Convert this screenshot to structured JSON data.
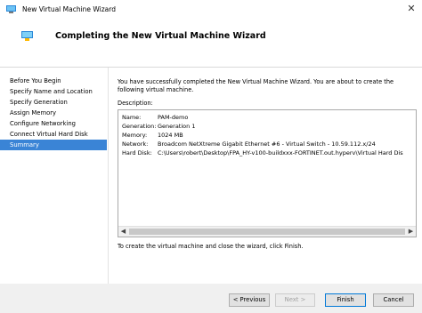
{
  "window": {
    "title": "New Virtual Machine Wizard",
    "close_glyph": "✕"
  },
  "header": {
    "title": "Completing the New Virtual Machine Wizard"
  },
  "nav": {
    "items": [
      {
        "label": "Before You Begin"
      },
      {
        "label": "Specify Name and Location"
      },
      {
        "label": "Specify Generation"
      },
      {
        "label": "Assign Memory"
      },
      {
        "label": "Configure Networking"
      },
      {
        "label": "Connect Virtual Hard Disk"
      },
      {
        "label": "Summary"
      }
    ],
    "selected": "Summary"
  },
  "content": {
    "intro": "You have successfully completed the New Virtual Machine Wizard. You are about to create the following virtual machine.",
    "description_label": "Description:",
    "summary": [
      {
        "label": "Name:",
        "value": "PAM-demo"
      },
      {
        "label": "Generation:",
        "value": "Generation 1"
      },
      {
        "label": "Memory:",
        "value": "1024 MB"
      },
      {
        "label": "Network:",
        "value": "Broadcom NetXtreme Gigabit Ethernet #6 - Virtual Switch - 10.59.112.x/24"
      },
      {
        "label": "Hard Disk:",
        "value": "C:\\Users\\robert\\Desktop\\FPA_HY-v100-buildxxx-FORTINET.out.hyperv\\Virtual Hard Dis"
      }
    ],
    "finish_text": "To create the virtual machine and close the wizard, click Finish."
  },
  "footer": {
    "previous_label": "< Previous",
    "next_label": "Next >",
    "finish_label": "Finish",
    "cancel_label": "Cancel"
  },
  "colors": {
    "selection": "#3a84d6",
    "footer": "#f0f0f0"
  },
  "icons": {
    "app": "hyperv-vm-icon",
    "wizard": "hyperv-vm-icon"
  }
}
